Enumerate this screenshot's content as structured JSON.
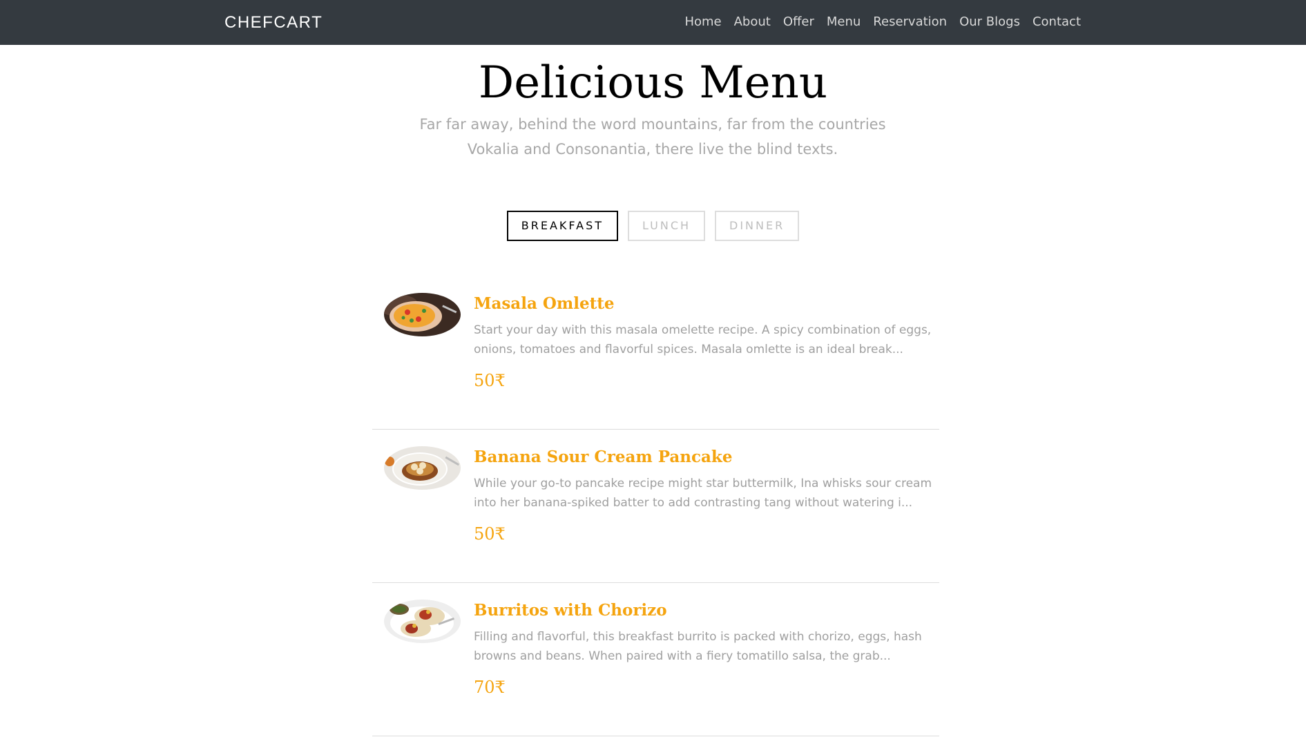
{
  "navbar": {
    "brand": "CHEFCART",
    "links": [
      "Home",
      "About",
      "Offer",
      "Menu",
      "Reservation",
      "Our Blogs",
      "Contact"
    ],
    "background": "#343a40"
  },
  "section": {
    "title": "Delicious Menu",
    "subtitle": "Far far away, behind the word mountains, far from the countries Vokalia and Consonantia, there live the blind texts."
  },
  "tabs": [
    {
      "label": "BREAKFAST",
      "active": true
    },
    {
      "label": "LUNCH",
      "active": false
    },
    {
      "label": "DINNER",
      "active": false
    }
  ],
  "menu": {
    "accent_color": "#f5a40f",
    "items": [
      {
        "image": "masala-omelette-image",
        "name": "Masala Omlette",
        "description": "Start your day with this masala omelette recipe. A spicy combination of eggs, onions, tomatoes and flavorful spices. Masala omlette is an ideal break...",
        "price": "50₹"
      },
      {
        "image": "pancake-image",
        "name": "Banana Sour Cream Pancake",
        "description": "While your go-to pancake recipe might star buttermilk, Ina whisks sour cream into her banana-spiked batter to add contrasting tang without watering i...",
        "price": "50₹"
      },
      {
        "image": "burrito-image",
        "name": "Burritos with Chorizo",
        "description": "Filling and flavorful, this breakfast burrito is packed with chorizo, eggs, hash browns and beans. When paired with a fiery tomatillo salsa, the grab...",
        "price": "70₹"
      }
    ]
  }
}
